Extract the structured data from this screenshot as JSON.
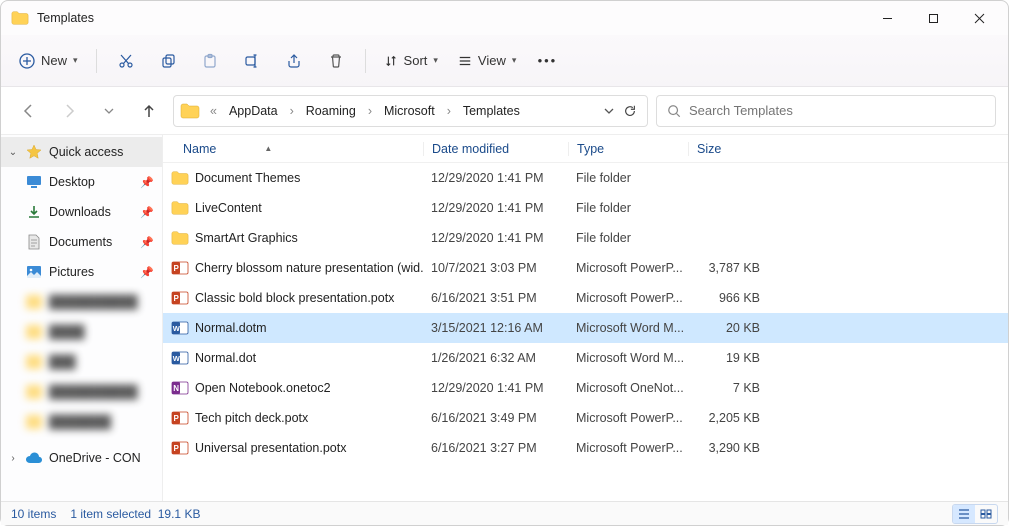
{
  "title": "Templates",
  "toolbar": {
    "new_label": "New",
    "sort_label": "Sort",
    "view_label": "View"
  },
  "breadcrumb": {
    "prefix": "«",
    "parts": [
      "AppData",
      "Roaming",
      "Microsoft",
      "Templates"
    ]
  },
  "search": {
    "placeholder": "Search Templates"
  },
  "sidebar": {
    "quick_access": "Quick access",
    "items": [
      {
        "label": "Desktop",
        "icon": "desktop",
        "pinned": true
      },
      {
        "label": "Downloads",
        "icon": "downloads",
        "pinned": true
      },
      {
        "label": "Documents",
        "icon": "documents",
        "pinned": true
      },
      {
        "label": "Pictures",
        "icon": "pictures",
        "pinned": true
      }
    ],
    "onedrive": "OneDrive - CON"
  },
  "columns": {
    "name": "Name",
    "date": "Date modified",
    "type": "Type",
    "size": "Size"
  },
  "rows": [
    {
      "name": "Document Themes",
      "date": "12/29/2020 1:41 PM",
      "type": "File folder",
      "size": "",
      "icon": "folder",
      "selected": false
    },
    {
      "name": "LiveContent",
      "date": "12/29/2020 1:41 PM",
      "type": "File folder",
      "size": "",
      "icon": "folder",
      "selected": false
    },
    {
      "name": "SmartArt Graphics",
      "date": "12/29/2020 1:41 PM",
      "type": "File folder",
      "size": "",
      "icon": "folder",
      "selected": false
    },
    {
      "name": "Cherry blossom nature presentation (wid...",
      "date": "10/7/2021 3:03 PM",
      "type": "Microsoft PowerP...",
      "size": "3,787 KB",
      "icon": "ppt",
      "selected": false
    },
    {
      "name": "Classic bold block presentation.potx",
      "date": "6/16/2021 3:51 PM",
      "type": "Microsoft PowerP...",
      "size": "966 KB",
      "icon": "ppt",
      "selected": false
    },
    {
      "name": "Normal.dotm",
      "date": "3/15/2021 12:16 AM",
      "type": "Microsoft Word M...",
      "size": "20 KB",
      "icon": "word",
      "selected": true
    },
    {
      "name": "Normal.dot",
      "date": "1/26/2021 6:32 AM",
      "type": "Microsoft Word M...",
      "size": "19 KB",
      "icon": "word",
      "selected": false
    },
    {
      "name": "Open Notebook.onetoc2",
      "date": "12/29/2020 1:41 PM",
      "type": "Microsoft OneNot...",
      "size": "7 KB",
      "icon": "onenote",
      "selected": false
    },
    {
      "name": "Tech pitch deck.potx",
      "date": "6/16/2021 3:49 PM",
      "type": "Microsoft PowerP...",
      "size": "2,205 KB",
      "icon": "ppt",
      "selected": false
    },
    {
      "name": "Universal presentation.potx",
      "date": "6/16/2021 3:27 PM",
      "type": "Microsoft PowerP...",
      "size": "3,290 KB",
      "icon": "ppt",
      "selected": false
    }
  ],
  "status": {
    "count": "10 items",
    "selected": "1 item selected",
    "size": "19.1 KB"
  }
}
